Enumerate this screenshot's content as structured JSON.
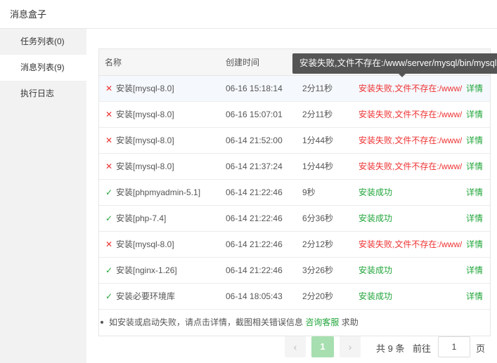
{
  "window": {
    "title": "消息盒子"
  },
  "sidebar": {
    "items": [
      {
        "label": "任务列表(0)"
      },
      {
        "label": "消息列表(9)"
      },
      {
        "label": "执行日志"
      }
    ]
  },
  "table": {
    "headers": {
      "name": "名称",
      "created": "创建时间",
      "duration": "",
      "status": "",
      "op": ""
    },
    "rows": [
      {
        "icon": "✕",
        "name": "安装[mysql-8.0]",
        "created": "06-16 15:18:14",
        "duration": "2分11秒",
        "status": "安装失败,文件不存在:/www/server/mysql/bin/mysql",
        "op": "详情"
      },
      {
        "icon": "✕",
        "name": "安装[mysql-8.0]",
        "created": "06-16 15:07:01",
        "duration": "2分11秒",
        "status": "安装失败,文件不存在:/www/server/mysql/bin/mysql",
        "op": "详情"
      },
      {
        "icon": "✕",
        "name": "安装[mysql-8.0]",
        "created": "06-14 21:52:00",
        "duration": "1分44秒",
        "status": "安装失败,文件不存在:/www/server/mysql/bin/mysql",
        "op": "详情"
      },
      {
        "icon": "✕",
        "name": "安装[mysql-8.0]",
        "created": "06-14 21:37:24",
        "duration": "1分44秒",
        "status": "安装失败,文件不存在:/www/server/mysql/bin/mysql",
        "op": "详情"
      },
      {
        "icon": "✓",
        "name": "安装[phpmyadmin-5.1]",
        "created": "06-14 21:22:46",
        "duration": "9秒",
        "status": "安装成功",
        "op": "详情"
      },
      {
        "icon": "✓",
        "name": "安装[php-7.4]",
        "created": "06-14 21:22:46",
        "duration": "6分36秒",
        "status": "安装成功",
        "op": "详情"
      },
      {
        "icon": "✕",
        "name": "安装[mysql-8.0]",
        "created": "06-14 21:22:46",
        "duration": "2分12秒",
        "status": "安装失败,文件不存在:/www/server/mysql/bin/mysql",
        "op": "详情"
      },
      {
        "icon": "✓",
        "name": "安装[nginx-1.26]",
        "created": "06-14 21:22:46",
        "duration": "3分26秒",
        "status": "安装成功",
        "op": "详情"
      },
      {
        "icon": "✓",
        "name": "安装必要环境库",
        "created": "06-14 18:05:43",
        "duration": "2分20秒",
        "status": "安装成功",
        "op": "详情"
      }
    ]
  },
  "tooltip": {
    "text": "安装失败,文件不存在:/www/server/mysql/bin/mysql"
  },
  "note": {
    "text": "如安装或启动失败，请点击详情，截图相关错误信息",
    "link": "咨询客服",
    "suffix": "求助"
  },
  "pager": {
    "prev": "‹",
    "current": "1",
    "next": "›",
    "total": "共 9 条",
    "goto": "前往",
    "page_value": "1",
    "page_unit": "页"
  },
  "colors": {
    "accent": "#20a53a",
    "error": "#e33333",
    "sidebar_bg": "#f2f2f2"
  }
}
